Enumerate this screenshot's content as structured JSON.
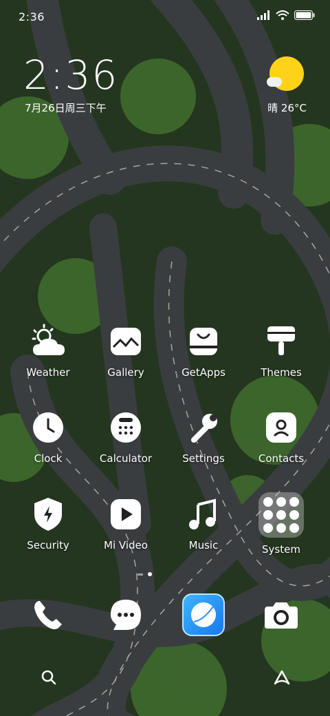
{
  "status_bar": {
    "time": "2:36"
  },
  "clock_widget": {
    "time": "2:36",
    "date": "7月26日周三下午"
  },
  "weather_widget": {
    "text": "晴 26°C"
  },
  "apps": [
    {
      "id": "weather",
      "label": "Weather",
      "icon": "weather-icon"
    },
    {
      "id": "gallery",
      "label": "Gallery",
      "icon": "gallery-icon"
    },
    {
      "id": "getapps",
      "label": "GetApps",
      "icon": "getapps-icon"
    },
    {
      "id": "themes",
      "label": "Themes",
      "icon": "themes-icon"
    },
    {
      "id": "clock",
      "label": "Clock",
      "icon": "clock-icon"
    },
    {
      "id": "calculator",
      "label": "Calculator",
      "icon": "calculator-icon"
    },
    {
      "id": "settings",
      "label": "Settings",
      "icon": "settings-icon"
    },
    {
      "id": "contacts",
      "label": "Contacts",
      "icon": "contacts-icon"
    },
    {
      "id": "security",
      "label": "Security",
      "icon": "security-icon"
    },
    {
      "id": "mivideo",
      "label": "Mi Video",
      "icon": "video-icon"
    },
    {
      "id": "music",
      "label": "Music",
      "icon": "music-icon"
    },
    {
      "id": "system",
      "label": "System",
      "icon": "folder-icon"
    }
  ],
  "dock": [
    {
      "id": "phone",
      "icon": "phone-icon"
    },
    {
      "id": "messages",
      "icon": "messages-icon"
    },
    {
      "id": "browser",
      "icon": "browser-icon"
    },
    {
      "id": "camera",
      "icon": "camera-icon"
    }
  ],
  "pager": {
    "pages": 2,
    "current": 1
  },
  "colors": {
    "sun": "#ffd21a",
    "browser": "#1679f0"
  }
}
